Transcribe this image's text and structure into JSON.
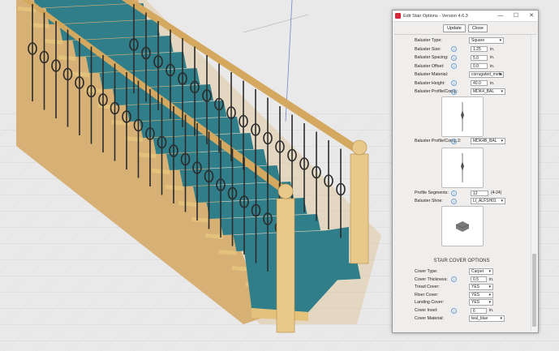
{
  "window": {
    "title": "Edit Stair Options - Version 4.6.3",
    "min_symbol": "—",
    "max_symbol": "☐",
    "close_symbol": "✕"
  },
  "toolbar": {
    "update_label": "Update",
    "close_label": "Close"
  },
  "baluster_rows": [
    {
      "label": "Baluster Type:",
      "kind": "select",
      "value": "Square"
    },
    {
      "label": "Baluster Size:",
      "kind": "field",
      "value": "1.25",
      "unit": "in.",
      "info": true
    },
    {
      "label": "Baluster Spacing:",
      "kind": "field",
      "value": "5.0",
      "unit": "in.",
      "info": true
    },
    {
      "label": "Baluster Offset:",
      "kind": "field",
      "value": "0.0",
      "unit": "in.",
      "info": true
    },
    {
      "label": "Baluster Material:",
      "kind": "select",
      "value": "corrugated_meta"
    },
    {
      "label": "Baluster Height:",
      "kind": "field",
      "value": "40.0",
      "unit": "in.",
      "info": true
    },
    {
      "label": "Baluster Profile/Comp:",
      "kind": "select",
      "value": "MDK4_BAL",
      "info": true
    }
  ],
  "profile2": {
    "label": "Baluster Profile/Comp 2:",
    "value": "MDK4B_BAL"
  },
  "profile_segments": {
    "label": "Profile Segments:",
    "value": "12",
    "hint": "(4-24)"
  },
  "baluster_shoe": {
    "label": "Baluster Shoe:",
    "value": "LI_ALFSH01"
  },
  "cover": {
    "section_title": "STAIR COVER OPTIONS",
    "rows": [
      {
        "label": "Cover Type:",
        "kind": "select",
        "value": "Carpet"
      },
      {
        "label": "Cover Thickness:",
        "kind": "field",
        "value": "0.5",
        "unit": "in.",
        "info": true
      },
      {
        "label": "Tread Cover:",
        "kind": "select",
        "value": "YES"
      },
      {
        "label": "Riser Cover:",
        "kind": "select",
        "value": "YES"
      },
      {
        "label": "Landing Cover:",
        "kind": "select",
        "value": "YES"
      },
      {
        "label": "Cover Inset:",
        "kind": "field",
        "value": "6",
        "unit": "in.",
        "info": true
      },
      {
        "label": "Cover Material:",
        "kind": "select",
        "value": "teal_blue"
      }
    ]
  },
  "icons": {
    "info": "info-icon",
    "dropdown": "chevron-down-icon"
  },
  "colors": {
    "carpet": "#2f7e8a",
    "wood": "#e3c27c",
    "viewport_bg": "#e7e7e7"
  }
}
